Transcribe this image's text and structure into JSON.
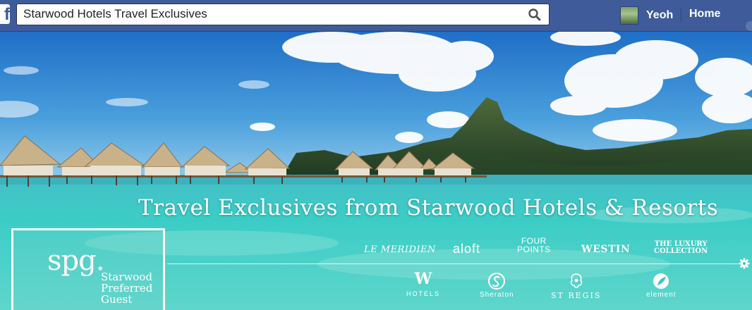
{
  "topbar": {
    "logo": "f",
    "search_value": "Starwood Hotels Travel Exclusives",
    "profile_name": "Yeoh",
    "home_label": "Home"
  },
  "cover": {
    "headline": "Travel Exclusives from Starwood Hotels & Resorts",
    "spg": {
      "logo": "spg.",
      "line1": "Starwood",
      "line2": "Preferred",
      "line3": "Guest"
    },
    "brands": {
      "meridien": "LE MERIDIEN",
      "aloft": "aloft",
      "four_points_1": "FOUR",
      "four_points_2": "POINTS",
      "westin": "WESTIN",
      "luxury_1": "THE LUXURY",
      "luxury_2": "COLLECTION",
      "w": "W",
      "w_sub": "HOTELS",
      "sheraton": "Sheraton",
      "st_regis": "ST REGIS",
      "element": "element"
    }
  },
  "colors": {
    "facebook_blue": "#3f5b99",
    "lagoon": "#3fc9c6",
    "sky": "#2c7fd0"
  }
}
